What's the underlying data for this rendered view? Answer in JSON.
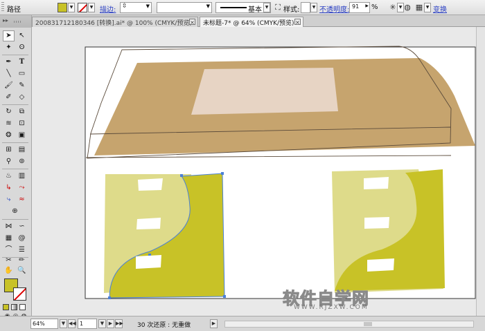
{
  "control_bar": {
    "selection_label": "路径",
    "stroke_link": "描边:",
    "stroke_profile": "基本",
    "style_label": "样式:",
    "opacity_link": "不透明度:",
    "opacity_value": "91",
    "opacity_unit": "%",
    "transform_link": "变换",
    "fill_color": "#c8c227"
  },
  "tabs": [
    {
      "label": "200831712180346 [转换].ai* @ 100% (CMYK/预览)",
      "close": "×"
    },
    {
      "label": "未标题-7* @ 64% (CMYK/预览)",
      "close": "×"
    }
  ],
  "tools_panel": {
    "header_label": "▸▸",
    "tool_icons": [
      "selection-tool",
      "direct-selection-tool",
      "magic-wand-tool",
      "lasso-tool",
      "pen-tool",
      "type-tool",
      "line-tool",
      "rectangle-tool",
      "paintbrush-tool",
      "pencil-tool",
      "blob-brush-tool",
      "eraser-tool",
      "rotate-tool",
      "scale-tool",
      "warp-tool",
      "free-transform-tool",
      "symbol-sprayer-tool",
      "graph-tool",
      "mesh-tool",
      "gradient-tool",
      "eyedropper-tool",
      "blend-tool",
      "live-paint-tool",
      "slice-tool",
      "hand-tool",
      "zoom-tool"
    ]
  },
  "status_bar": {
    "zoom": "64%",
    "page_number": "1",
    "undo_info": "30 次还原 : 无重做"
  },
  "watermark": {
    "cn": "软件自学网",
    "url": "WWW.RJZXW.COM"
  },
  "artwork_colors": {
    "table_top": "#c6a46e",
    "table_top_center": "#e7d4c4",
    "leg_light": "#dedb8a",
    "leg_dark": "#c8c227",
    "drawer_slot": "#ffffff",
    "selection_blue": "#4a80d8"
  }
}
